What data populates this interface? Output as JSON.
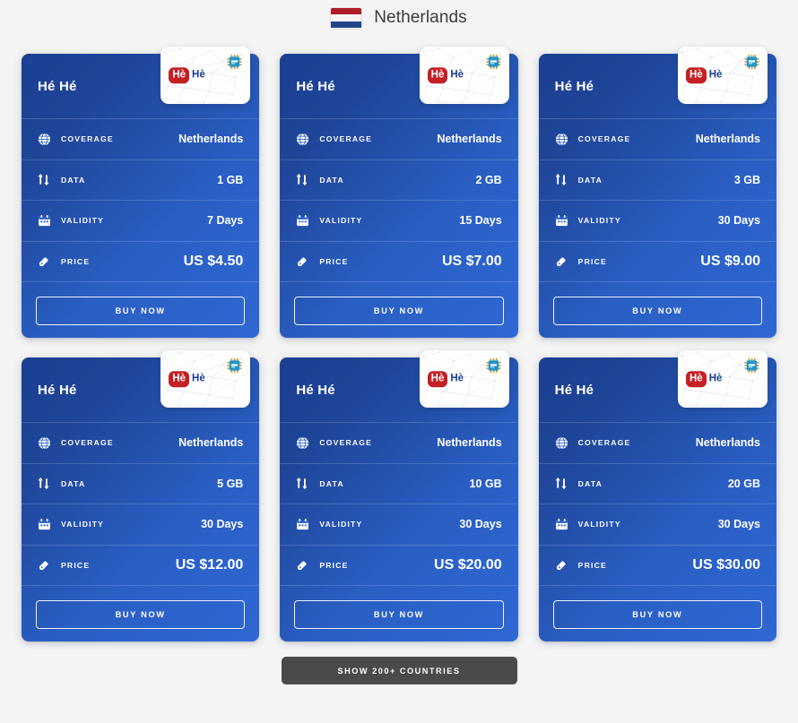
{
  "header": {
    "country": "Netherlands",
    "flag_icon": "netherlands-flag",
    "flag_colors": [
      "#AE1C28",
      "#FFFFFF",
      "#21468B"
    ]
  },
  "theme": {
    "page_background": "#f4f4f4",
    "card_gradient_from": "#1b3f92",
    "card_gradient_to": "#2e68d4",
    "logo_badge_color": "#c42026",
    "logo_word_color": "#1b3f92",
    "footer_button_color": "#4a4a4a",
    "text_color": "#ffffff"
  },
  "brand": {
    "badge_text": "Hè",
    "word_text": "Hè",
    "chip_icon": "sim-chip-icon"
  },
  "labels": {
    "coverage": "COVERAGE",
    "data": "DATA",
    "validity": "VALIDITY",
    "price": "PRICE",
    "buy_now": "BUY NOW"
  },
  "icons": {
    "coverage": "globe-icon",
    "data": "data-transfer-icon",
    "validity": "calendar-icon",
    "price": "price-tag-icon"
  },
  "footer": {
    "show_countries": "SHOW 200+ COUNTRIES"
  },
  "plans": [
    {
      "name": "Hé Hé",
      "coverage": "Netherlands",
      "data": "1 GB",
      "validity": "7 Days",
      "price": "US $4.50"
    },
    {
      "name": "Hé Hé",
      "coverage": "Netherlands",
      "data": "2 GB",
      "validity": "15 Days",
      "price": "US $7.00"
    },
    {
      "name": "Hé Hé",
      "coverage": "Netherlands",
      "data": "3 GB",
      "validity": "30 Days",
      "price": "US $9.00"
    },
    {
      "name": "Hé Hé",
      "coverage": "Netherlands",
      "data": "5 GB",
      "validity": "30 Days",
      "price": "US $12.00"
    },
    {
      "name": "Hé Hé",
      "coverage": "Netherlands",
      "data": "10 GB",
      "validity": "30 Days",
      "price": "US $20.00"
    },
    {
      "name": "Hé Hé",
      "coverage": "Netherlands",
      "data": "20 GB",
      "validity": "30 Days",
      "price": "US $30.00"
    }
  ]
}
